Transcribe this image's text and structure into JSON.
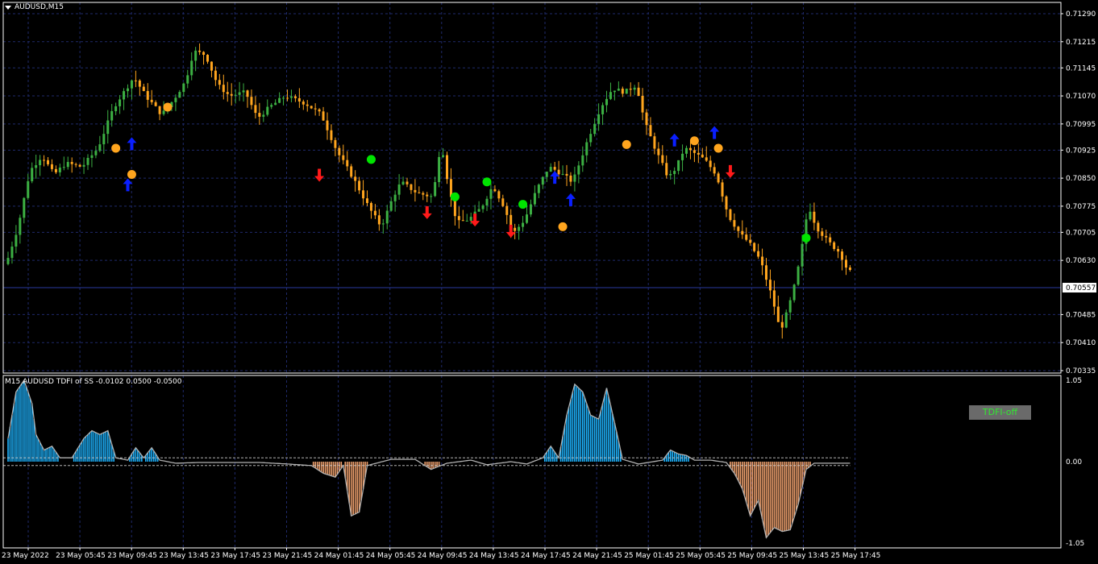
{
  "window": {
    "symbol_title": "AUDUSD,M15"
  },
  "indicator": {
    "title": "M15 AUDUSD TDFI of SS -0.0102 0.0500 -0.0500",
    "button_label": "TDFI-off",
    "levels": [
      1.05,
      0.0,
      -1.05
    ],
    "level_labels": [
      "1.05",
      "0.00",
      "-1.05"
    ]
  },
  "price_axis": {
    "labels": [
      "0.71290",
      "0.71215",
      "0.71145",
      "0.71070",
      "0.70995",
      "0.70925",
      "0.70850",
      "0.70775",
      "0.70705",
      "0.70630",
      "0.70557",
      "0.70485",
      "0.70410",
      "0.70335"
    ],
    "current_price": "0.70557"
  },
  "time_axis": {
    "labels": [
      "23 May 2022",
      "23 May 05:45",
      "23 May 09:45",
      "23 May 13:45",
      "23 May 17:45",
      "23 May 21:45",
      "24 May 01:45",
      "24 May 05:45",
      "24 May 09:45",
      "24 May 13:45",
      "24 May 17:45",
      "24 May 21:45",
      "25 May 01:45",
      "25 May 05:45",
      "25 May 09:45",
      "25 May 13:45",
      "25 May 17:45"
    ]
  },
  "colors": {
    "up_candle": "#3cb043",
    "down_candle": "#ffa51e",
    "grid": "#1f2a6b",
    "buy_arrow": "#0a1fff",
    "sell_arrow": "#ff1a1a",
    "green_dot": "#00e400",
    "orange_dot": "#ffa51e",
    "hist_positive": "#1eb4ff",
    "hist_negative": "#f4a470",
    "tdfi_line": "#b0b0b0",
    "current_price_line": "#2a3aa0"
  },
  "chart_data": {
    "type": "candlestick",
    "symbol": "AUDUSD",
    "timeframe": "M15",
    "price_range": [
      0.70335,
      0.7129
    ],
    "current_price": 0.70557,
    "path_points": [
      [
        0,
        0.7062
      ],
      [
        3,
        0.7072
      ],
      [
        6,
        0.7087
      ],
      [
        9,
        0.7091
      ],
      [
        12,
        0.7086
      ],
      [
        15,
        0.7089
      ],
      [
        19,
        0.7088
      ],
      [
        23,
        0.7093
      ],
      [
        27,
        0.7104
      ],
      [
        32,
        0.7112
      ],
      [
        35,
        0.7107
      ],
      [
        39,
        0.7102
      ],
      [
        42,
        0.7106
      ],
      [
        45,
        0.7111
      ],
      [
        47,
        0.7119
      ],
      [
        50,
        0.7118
      ],
      [
        53,
        0.711
      ],
      [
        56,
        0.7107
      ],
      [
        60,
        0.7108
      ],
      [
        63,
        0.7101
      ],
      [
        66,
        0.7104
      ],
      [
        70,
        0.7107
      ],
      [
        75,
        0.7105
      ],
      [
        79,
        0.7102
      ],
      [
        83,
        0.7092
      ],
      [
        87,
        0.7085
      ],
      [
        91,
        0.7077
      ],
      [
        94,
        0.7072
      ],
      [
        97,
        0.708
      ],
      [
        99,
        0.7084
      ],
      [
        103,
        0.7081
      ],
      [
        107,
        0.708
      ],
      [
        109,
        0.7095
      ],
      [
        111,
        0.7082
      ],
      [
        113,
        0.7073
      ],
      [
        116,
        0.7074
      ],
      [
        119,
        0.7077
      ],
      [
        122,
        0.7083
      ],
      [
        125,
        0.7077
      ],
      [
        127,
        0.707
      ],
      [
        130,
        0.7074
      ],
      [
        133,
        0.7082
      ],
      [
        136,
        0.7088
      ],
      [
        138,
        0.7087
      ],
      [
        142,
        0.7084
      ],
      [
        146,
        0.7096
      ],
      [
        149,
        0.7104
      ],
      [
        152,
        0.7109
      ],
      [
        155,
        0.7108
      ],
      [
        158,
        0.711
      ],
      [
        160,
        0.71
      ],
      [
        163,
        0.7092
      ],
      [
        166,
        0.7085
      ],
      [
        168,
        0.7088
      ],
      [
        170,
        0.7093
      ],
      [
        172,
        0.7092
      ],
      [
        175,
        0.709
      ],
      [
        178,
        0.7086
      ],
      [
        181,
        0.7075
      ],
      [
        184,
        0.707
      ],
      [
        186,
        0.7068
      ],
      [
        189,
        0.7063
      ],
      [
        192,
        0.7053
      ],
      [
        194,
        0.7044
      ],
      [
        196,
        0.705
      ],
      [
        198,
        0.7058
      ],
      [
        200,
        0.707
      ],
      [
        201,
        0.7078
      ],
      [
        203,
        0.7072
      ],
      [
        206,
        0.7068
      ],
      [
        209,
        0.7065
      ],
      [
        211,
        0.706
      ]
    ],
    "buy_arrows": [
      [
        30,
        0.7083
      ],
      [
        31,
        0.7094
      ],
      [
        137,
        0.7085
      ],
      [
        141,
        0.7079
      ],
      [
        167,
        0.7095
      ],
      [
        177,
        0.7097
      ]
    ],
    "sell_arrows": [
      [
        78,
        0.7086
      ],
      [
        105,
        0.7076
      ],
      [
        117,
        0.7074
      ],
      [
        126,
        0.7071
      ],
      [
        181,
        0.7087
      ]
    ],
    "orange_dots": [
      [
        27,
        0.7093
      ],
      [
        31,
        0.7086
      ],
      [
        40,
        0.7104
      ],
      [
        139,
        0.7072
      ],
      [
        155,
        0.7094
      ],
      [
        172,
        0.7095
      ],
      [
        178,
        0.7093
      ]
    ],
    "green_dots": [
      [
        91,
        0.709
      ],
      [
        112,
        0.708
      ],
      [
        120,
        0.7084
      ],
      [
        129,
        0.7078
      ],
      [
        200,
        0.7069
      ]
    ],
    "tdfi_histogram": {
      "range": [
        -1.05,
        1.05
      ],
      "levels": [
        0.05,
        -0.05
      ],
      "points": [
        [
          0,
          0.3
        ],
        [
          2,
          0.9
        ],
        [
          4,
          1.05
        ],
        [
          6,
          0.75
        ],
        [
          7,
          0.35
        ],
        [
          9,
          0.15
        ],
        [
          11,
          0.2
        ],
        [
          13,
          0.05
        ],
        [
          16,
          0.05
        ],
        [
          19,
          0.3
        ],
        [
          21,
          0.4
        ],
        [
          23,
          0.35
        ],
        [
          25,
          0.4
        ],
        [
          27,
          0.05
        ],
        [
          30,
          0.02
        ],
        [
          32,
          0.18
        ],
        [
          34,
          0.05
        ],
        [
          36,
          0.18
        ],
        [
          38,
          0.02
        ],
        [
          42,
          -0.02
        ],
        [
          48,
          -0.01
        ],
        [
          55,
          -0.01
        ],
        [
          63,
          -0.01
        ],
        [
          70,
          -0.03
        ],
        [
          76,
          -0.05
        ],
        [
          79,
          -0.15
        ],
        [
          82,
          -0.2
        ],
        [
          84,
          -0.05
        ],
        [
          86,
          -0.7
        ],
        [
          88,
          -0.65
        ],
        [
          90,
          -0.05
        ],
        [
          96,
          0.03
        ],
        [
          102,
          0.03
        ],
        [
          106,
          -0.1
        ],
        [
          110,
          -0.02
        ],
        [
          116,
          0.02
        ],
        [
          120,
          -0.04
        ],
        [
          126,
          0.0
        ],
        [
          130,
          -0.03
        ],
        [
          134,
          0.05
        ],
        [
          136,
          0.2
        ],
        [
          138,
          0.05
        ],
        [
          140,
          0.6
        ],
        [
          142,
          1.0
        ],
        [
          144,
          0.9
        ],
        [
          146,
          0.6
        ],
        [
          148,
          0.55
        ],
        [
          150,
          0.95
        ],
        [
          152,
          0.5
        ],
        [
          154,
          0.03
        ],
        [
          158,
          -0.03
        ],
        [
          164,
          0.02
        ],
        [
          166,
          0.15
        ],
        [
          168,
          0.1
        ],
        [
          170,
          0.08
        ],
        [
          172,
          0.02
        ],
        [
          176,
          0.02
        ],
        [
          180,
          -0.01
        ],
        [
          182,
          -0.15
        ],
        [
          184,
          -0.35
        ],
        [
          186,
          -0.7
        ],
        [
          188,
          -0.5
        ],
        [
          190,
          -0.98
        ],
        [
          192,
          -0.85
        ],
        [
          194,
          -0.9
        ],
        [
          196,
          -0.88
        ],
        [
          198,
          -0.55
        ],
        [
          200,
          -0.1
        ],
        [
          202,
          -0.02
        ],
        [
          206,
          -0.02
        ],
        [
          209,
          -0.02
        ]
      ]
    }
  }
}
